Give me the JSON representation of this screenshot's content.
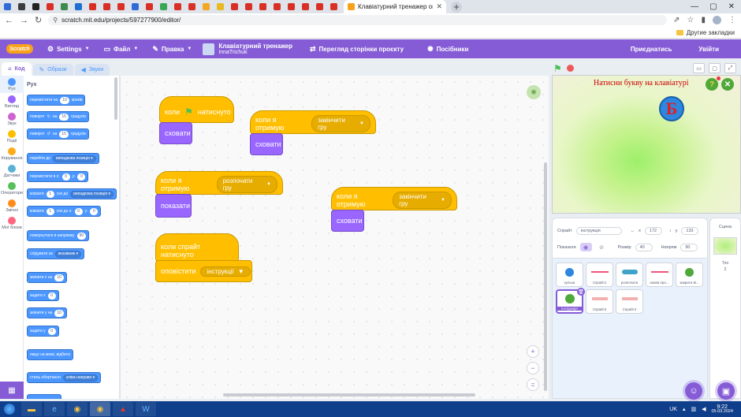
{
  "browser": {
    "active_tab_title": "Клавіатурний тренажер on Scratch",
    "url": "scratch.mit.edu/projects/597277900/editor/",
    "bookmarks_label": "Другие закладки",
    "mini_tab_colors": [
      "#2f6bd8",
      "#3c3c3c",
      "#222222",
      "#d93025",
      "#3c8a4d",
      "#1f6fd1",
      "#d93025",
      "#d93025",
      "#d93025",
      "#2f6bd8",
      "#d93025",
      "#3aa757",
      "#d93025",
      "#d93025",
      "#f5a623",
      "#e8b923",
      "#d93025",
      "#d93025",
      "#d93025",
      "#d93025",
      "#d93025",
      "#d93025",
      "#d93025",
      "#d93025"
    ]
  },
  "menubar": {
    "logo": "Scratch",
    "settings": "Settings",
    "file": "Файл",
    "edit": "Правка",
    "project_title": "Клавіатурний тренажер",
    "project_author": "InnaTrichuk",
    "project_page": "Перегляд сторінки проєкту",
    "tutorials": "Посібники",
    "share": "Приєднатись",
    "login": "Увійти"
  },
  "editor_tabs": {
    "code": "Код",
    "costumes": "Образи",
    "sounds": "Звуки"
  },
  "categories": [
    {
      "name": "Рух",
      "color": "#4c97ff"
    },
    {
      "name": "Вигляд",
      "color": "#9966ff"
    },
    {
      "name": "Звук",
      "color": "#cf63cf"
    },
    {
      "name": "Події",
      "color": "#ffbf00"
    },
    {
      "name": "Керування",
      "color": "#ffab19"
    },
    {
      "name": "Датчики",
      "color": "#5cb1d6"
    },
    {
      "name": "Оператори",
      "color": "#59c059"
    },
    {
      "name": "Змінні",
      "color": "#ff8c1a"
    },
    {
      "name": "Мої блоки",
      "color": "#ff6680"
    }
  ],
  "palette": {
    "title": "Рух",
    "b1": {
      "a": "перемістити на",
      "v": "10",
      "b": "кроків"
    },
    "b2": {
      "a": "поворот",
      "v": "15",
      "b": "градусів"
    },
    "b3": {
      "a": "поворот",
      "v": "15",
      "b": "градусів"
    },
    "b4": {
      "a": "перейти до",
      "dd": "випадкова позиція"
    },
    "b5": {
      "a": "перемістити в x:",
      "v1": "0",
      "b": "y:",
      "v2": "0"
    },
    "b6": {
      "a": "ковзати",
      "v": "1",
      "b": "сек до",
      "dd": "випадкова позиція"
    },
    "b7": {
      "a": "ковзати",
      "v1": "1",
      "b": "сек до x:",
      "v2": "0",
      "c": "y:",
      "v3": "0"
    },
    "b8": {
      "a": "повернутися в напрямку",
      "v": "90"
    },
    "b9": {
      "a": "слідувати за",
      "dd": "вказівник"
    },
    "b10": {
      "a": "змінити x на",
      "v": "10"
    },
    "b11": {
      "a": "задати x",
      "v": "0"
    },
    "b12": {
      "a": "змінити y на",
      "v": "10"
    },
    "b13": {
      "a": "задати y",
      "v": "0"
    },
    "b14": {
      "a": "якщо на межі, відбити"
    },
    "b15": {
      "a": "стиль обертання",
      "dd": "зліва-направо"
    }
  },
  "scripts": {
    "s1_hat": "коли",
    "s1_hat_b": "натиснуто",
    "s1_block": "сховати",
    "s2_hat": "коли я отримую",
    "s2_msg": "закінчити гру",
    "s2_block": "сховати",
    "s3_hat": "коли я отримую",
    "s3_msg": "розпочати гру",
    "s3_block": "показати",
    "s4_hat": "коли я отримую",
    "s4_msg": "закінчити гру",
    "s4_block": "сховати",
    "s5_hat": "коли спрайт натиснуто",
    "s5_block": "оповістити",
    "s5_msg": "інструкції"
  },
  "stage": {
    "text": "Натисни букву на клавіатурі",
    "letter": "Б",
    "q": "?",
    "x": "✕"
  },
  "sprite_info": {
    "sprite_label": "Спрайт",
    "sprite_name": "інструкція",
    "x_label": "x",
    "x": "172",
    "y_label": "y",
    "y": "133",
    "show_label": "Показати",
    "size_label": "Розмір",
    "size": "40",
    "direction_label": "Напрям",
    "direction": "90"
  },
  "sprites": [
    {
      "name": "кулька"
    },
    {
      "name": "Спрайт1"
    },
    {
      "name": "розпочати"
    },
    {
      "name": "назва про..."
    },
    {
      "name": "закрити ві..."
    },
    {
      "name": "інструкція"
    },
    {
      "name": "Спрайт3"
    },
    {
      "name": "Спрайт4"
    }
  ],
  "stage_pane": {
    "title": "Сцена",
    "backdrops_label": "Тло",
    "backdrops_count": "2"
  },
  "taskbar": {
    "lang": "UK",
    "time": "9:22",
    "date": "05.03.2024"
  }
}
